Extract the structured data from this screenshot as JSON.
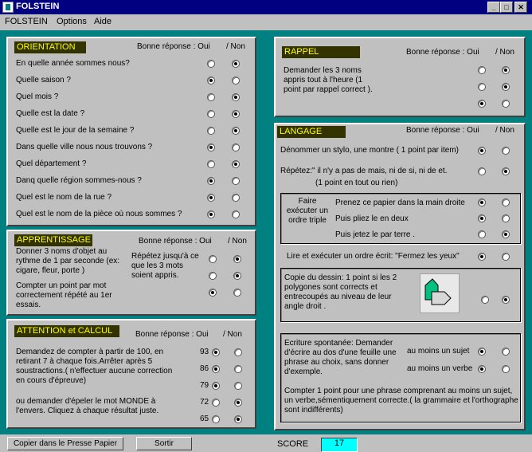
{
  "window": {
    "title": "FOLSTEIN",
    "minimize": "_",
    "maximize": "□",
    "close": "✕"
  },
  "menu": [
    "FOLSTEIN",
    "Options",
    "Aide"
  ],
  "header": {
    "bonne": "Bonne réponse : Oui",
    "non": "/ Non"
  },
  "orientation": {
    "label": "ORIENTATION",
    "questions": [
      {
        "text": "En quelle année sommes nous?",
        "answer": "non"
      },
      {
        "text": "Quelle saison ?",
        "answer": "oui"
      },
      {
        "text": "Quel mois ?",
        "answer": "non"
      },
      {
        "text": "Quelle est la date ?",
        "answer": "non"
      },
      {
        "text": "Quelle est le jour de la semaine ?",
        "answer": "non"
      },
      {
        "text": "Dans quelle ville nous nous trouvons ?",
        "answer": "oui"
      },
      {
        "text": "Quel département ?",
        "answer": "non"
      },
      {
        "text": "Danq quelle région sommes-nous ?",
        "answer": "oui"
      },
      {
        "text": "Quel est le nom de la rue ?",
        "answer": "oui"
      },
      {
        "text": "Quel est le nom de la pièce où nous sommes ?",
        "answer": "oui"
      }
    ]
  },
  "apprentissage": {
    "label": "APPRENTISSAGE",
    "instr1": "Donner 3 noms d'objet au rythme de 1 par seconde (ex: cigare, fleur, porte )",
    "instr2": "Compter un point par mot correctement répété au 1er essais.",
    "repetez": "Répétez jusqu'à ce que les 3 mots soient appris.",
    "answers": [
      "non",
      "non",
      "oui"
    ]
  },
  "attention": {
    "label": "ATTENTION et CALCUL",
    "instr1": "Demandez de compter à partir de 100, en retirant 7 à chaque fois.Arrêter après 5 soustractions.( n'effectuer aucune correction en cours d'épreuve)",
    "instr2": "ou demander d'épeler le mot MONDE à l'envers. Cliquez à chaque résultat juste.",
    "rows": [
      {
        "value": "93",
        "answer": "oui"
      },
      {
        "value": "86",
        "answer": "oui"
      },
      {
        "value": "79",
        "answer": "oui"
      },
      {
        "value": "72",
        "answer": "non"
      },
      {
        "value": "65",
        "answer": "non"
      }
    ]
  },
  "rappel": {
    "label": "RAPPEL",
    "text": "Demander les 3 noms appris tout à l'heure (1 point par rappel correct ).",
    "answers": [
      "non",
      "non",
      "oui"
    ]
  },
  "langage": {
    "label": "LANGAGE",
    "denommer": {
      "text": "Dénommer un stylo, une montre ( 1 point par item)",
      "answer": "oui"
    },
    "repetez": {
      "text": "Répétez:\" il n'y a pas de mais, ni de si, ni de et.",
      "sub": "(1 point en tout ou rien)",
      "answer": "non"
    },
    "triple": {
      "label": "Faire exécuter un ordre triple",
      "steps": [
        {
          "text": "Prenez ce papier dans la main droite",
          "answer": "oui"
        },
        {
          "text": "Puis pliez le en deux",
          "answer": "oui"
        },
        {
          "text": "Puis jetez le par terre .",
          "answer": "non"
        }
      ]
    },
    "lire": {
      "text": "Lire et exécuter un ordre écrit: \"Fermez les yeux\"",
      "answer": "oui"
    },
    "copie": {
      "text": "Copie du dessin: 1 point si les 2 polygones sont corrects et entrecoupés au niveau de leur angle droit .",
      "answer": "non"
    },
    "ecriture": {
      "text1": "Ecriture spontanée: Demander d'écrire au dos d'une feuille une phrase au choix, sans donner d'exemple.",
      "sujet": {
        "label": "au moins un sujet",
        "answer": "oui"
      },
      "verbe": {
        "label": "au moins un verbe",
        "answer": "oui"
      },
      "text2": "Compter 1 point pour une phrase comprenant au moins un sujet, un verbe,sémentiquement correcte.( la grammaire et l'orthographe sont indifférents)"
    }
  },
  "buttons": {
    "copier": "Copier dans le Presse Papier",
    "sortir": "Sortir"
  },
  "score": {
    "label": "SCORE",
    "value": "17"
  }
}
